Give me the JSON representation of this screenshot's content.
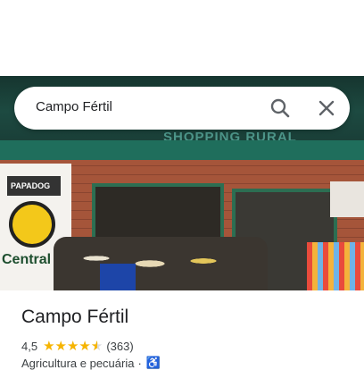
{
  "search": {
    "query": "Campo Fértil"
  },
  "photo": {
    "sign_text": "SHOPPING RURAL",
    "banner_brand": "PAPADOG",
    "banner_store": "Central"
  },
  "place": {
    "name": "Campo Fértil",
    "rating": "4,5",
    "stars_filled": 4.5,
    "review_count": "(363)",
    "category": "Agricultura e pecuária",
    "separator": "·"
  },
  "icons": {
    "search": "search-icon",
    "close": "close-icon",
    "accessibility": "wheelchair-icon"
  },
  "colors": {
    "stars": "#f6b400",
    "accent": "#1a73e8"
  }
}
